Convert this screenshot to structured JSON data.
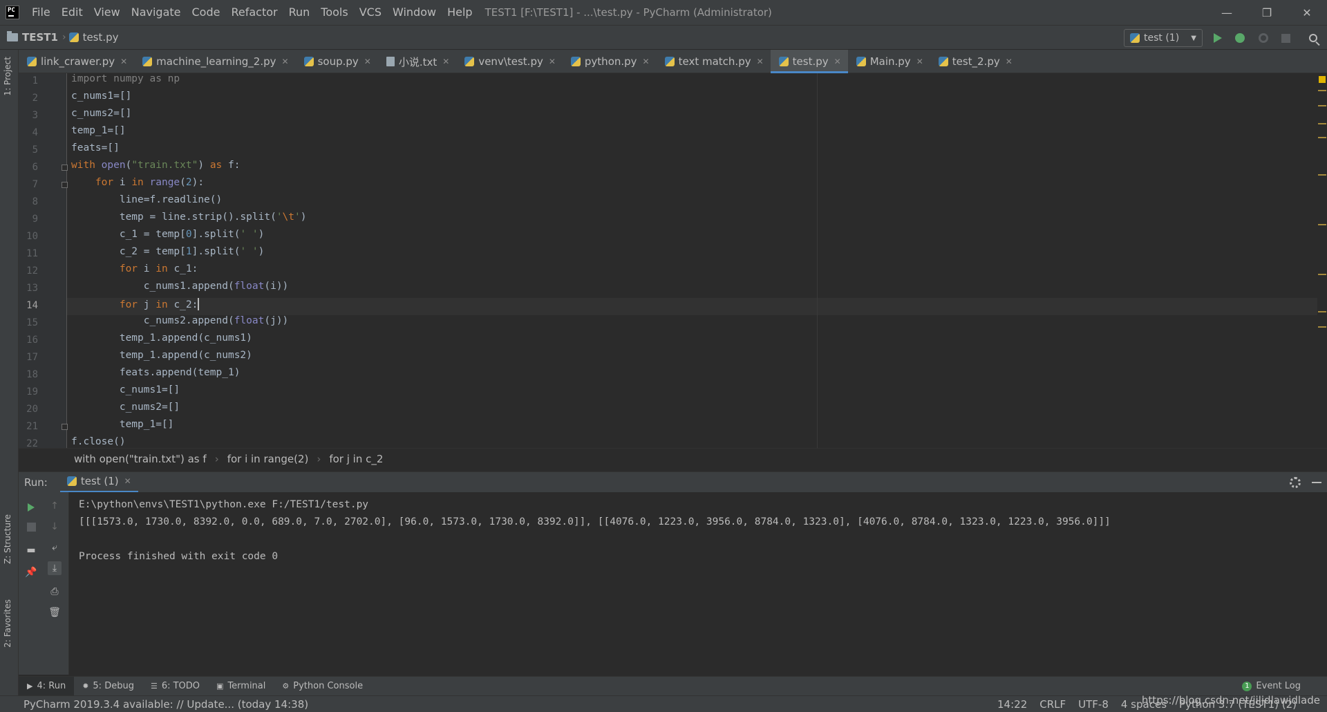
{
  "menubar": {
    "items": [
      "File",
      "Edit",
      "View",
      "Navigate",
      "Code",
      "Refactor",
      "Run",
      "Tools",
      "VCS",
      "Window",
      "Help"
    ],
    "window_title": "TEST1 [F:\\TEST1] - ...\\test.py - PyCharm (Administrator)"
  },
  "navbar": {
    "project": "TEST1",
    "file": "test.py",
    "run_config": "test (1)"
  },
  "left_strip": {
    "project": "1: Project",
    "structure": "Z: Structure",
    "favorites": "2: Favorites"
  },
  "tabs": [
    {
      "label": "link_crawer.py",
      "icon": "python-file-icon"
    },
    {
      "label": "machine_learning_2.py",
      "icon": "python-file-icon"
    },
    {
      "label": "soup.py",
      "icon": "python-file-icon"
    },
    {
      "label": "小说.txt",
      "icon": "text-file-icon"
    },
    {
      "label": "venv\\test.py",
      "icon": "python-file-icon"
    },
    {
      "label": "python.py",
      "icon": "python-file-icon"
    },
    {
      "label": "text match.py",
      "icon": "python-file-icon"
    },
    {
      "label": "test.py",
      "icon": "python-file-icon",
      "active": true
    },
    {
      "label": "Main.py",
      "icon": "python-file-icon"
    },
    {
      "label": "test_2.py",
      "icon": "python-file-icon"
    }
  ],
  "editor": {
    "current_line": 14,
    "line_numbers": [
      "1",
      "2",
      "3",
      "4",
      "5",
      "6",
      "7",
      "8",
      "9",
      "10",
      "11",
      "12",
      "13",
      "14",
      "15",
      "16",
      "17",
      "18",
      "19",
      "20",
      "21",
      "22"
    ]
  },
  "breadcrumbs": [
    "with open(\"train.txt\") as f",
    "for i in range(2)",
    "for j in c_2"
  ],
  "run": {
    "label": "Run:",
    "tab": "test (1)",
    "output": [
      "E:\\python\\envs\\TEST1\\python.exe F:/TEST1/test.py",
      "[[[1573.0, 1730.0, 8392.0, 0.0, 689.0, 7.0, 2702.0], [96.0, 1573.0, 1730.0, 8392.0]], [[4076.0, 1223.0, 3956.0, 8784.0, 1323.0], [4076.0, 8784.0, 1323.0, 1223.0, 3956.0]]]",
      "",
      "Process finished with exit code 0"
    ]
  },
  "tool_windows": {
    "run": "4: Run",
    "debug": "5: Debug",
    "todo": "6: TODO",
    "terminal": "Terminal",
    "console": "Python Console",
    "event_log": "Event Log",
    "event_count": "1"
  },
  "status": {
    "message": "PyCharm 2019.3.4 available: // Update... (today 14:38)",
    "position": "14:22",
    "line_sep": "CRLF",
    "encoding": "UTF-8",
    "indent": "4 spaces",
    "interpreter": "Python 3.7 (TEST1) (2)",
    "watermark": "https://blog.csdn.net/jiljdlawidlade"
  }
}
